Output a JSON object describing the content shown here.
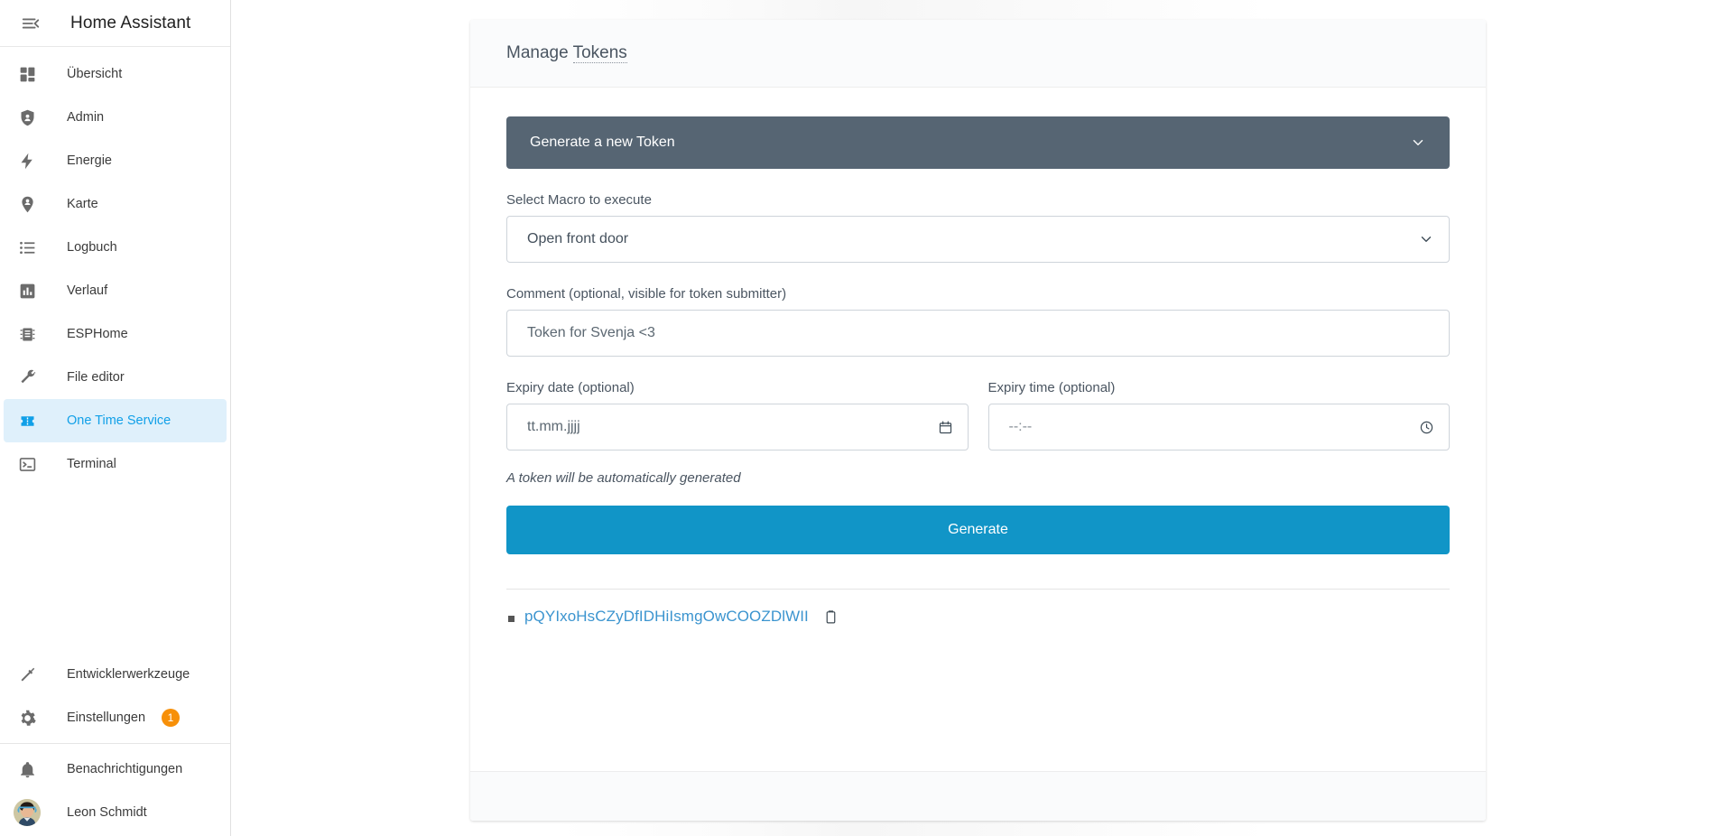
{
  "app": {
    "title": "Home Assistant",
    "menu_icon": "hamburger-collapse-icon"
  },
  "sidebar": {
    "items": [
      {
        "label": "Übersicht",
        "icon": "view-dashboard-icon",
        "active": false
      },
      {
        "label": "Admin",
        "icon": "shield-account-icon",
        "active": false
      },
      {
        "label": "Energie",
        "icon": "lightning-bolt-icon",
        "active": false
      },
      {
        "label": "Karte",
        "icon": "map-marker-account-icon",
        "active": false
      },
      {
        "label": "Logbuch",
        "icon": "format-list-bulleted-icon",
        "active": false
      },
      {
        "label": "Verlauf",
        "icon": "chart-box-icon",
        "active": false
      },
      {
        "label": "ESPHome",
        "icon": "chip-icon",
        "active": false
      },
      {
        "label": "File editor",
        "icon": "wrench-icon",
        "active": false
      },
      {
        "label": "One Time Service",
        "icon": "ticket-icon",
        "active": true
      },
      {
        "label": "Terminal",
        "icon": "console-icon",
        "active": false
      }
    ],
    "bottom_items": [
      {
        "label": "Entwicklerwerkzeuge",
        "icon": "hammer-icon",
        "badge": ""
      },
      {
        "label": "Einstellungen",
        "icon": "cog-icon",
        "badge": "1"
      }
    ],
    "footer_items": [
      {
        "label": "Benachrichtigungen",
        "icon": "bell-icon"
      },
      {
        "label": "Leon Schmidt",
        "icon": "user-avatar"
      }
    ],
    "badge_color": "#f79009",
    "active_color": "#11a0e8",
    "active_bg": "#dff0fb"
  },
  "card": {
    "title_prefix": "Manage ",
    "title_tooltip_word": "Tokens",
    "accordion": {
      "label": "Generate a new Token",
      "chevron": "chevron-down-icon",
      "bg": "#566573",
      "expanded": true
    },
    "fields": {
      "macro": {
        "label": "Select Macro to execute",
        "value": "Open front door",
        "chevron": "chevron-down-icon"
      },
      "comment": {
        "label": "Comment (optional, visible for token submitter)",
        "value": "Token for Svenja <3",
        "placeholder": ""
      },
      "expiry_date": {
        "label": "Expiry date (optional)",
        "placeholder": "tt.mm.jjjj",
        "value": "",
        "icon": "calendar-icon"
      },
      "expiry_time": {
        "label": "Expiry time (optional)",
        "placeholder": "--:--",
        "value": "",
        "icon": "clock-icon"
      }
    },
    "hint": "A token will be automatically generated",
    "generate_button": {
      "label": "Generate",
      "color": "#1195c7"
    },
    "tokens": [
      {
        "value": "pQYIxoHsCZyDfIDHiIsmgOwCOOZDlWII",
        "copy_icon": "clipboard-icon",
        "color": "#3b94cf"
      }
    ]
  }
}
